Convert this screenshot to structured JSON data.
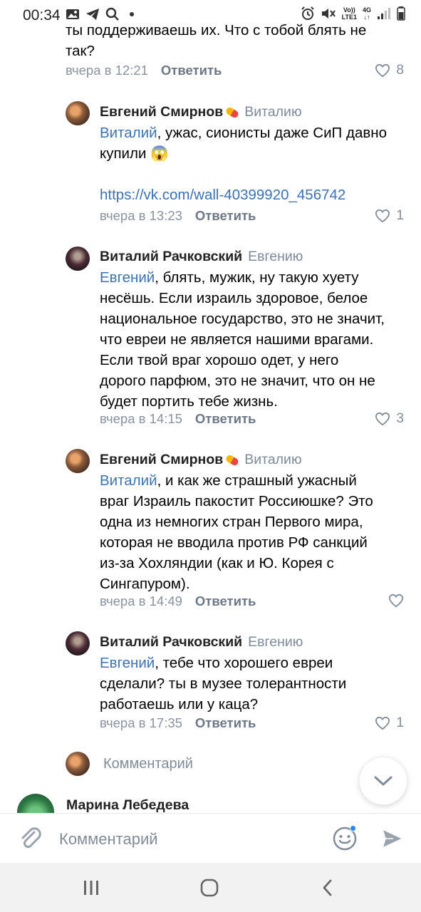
{
  "status": {
    "time": "00:34",
    "net_top": "Vo))",
    "net_bottom": "LTE1",
    "net_4g": "4G"
  },
  "top_partial": {
    "line1": "ты поддерживаешь их.  Что с тобой блять не",
    "line2": "так?",
    "time": "вчера в 12:21",
    "reply_label": "Ответить",
    "likes": "8"
  },
  "comments": [
    {
      "author": "Евгений Смирнов",
      "reply_to": "Виталию",
      "mention": "Виталий",
      "text_lines": [
        ", ужас, сионисты даже СиП давно",
        "купили 😱"
      ],
      "link": "https://vk.com/wall-40399920_456742",
      "time": "вчера в 13:23",
      "reply_label": "Ответить",
      "likes": "1"
    },
    {
      "author": "Виталий Рачковский",
      "reply_to": "Евгению",
      "mention": "Евгений",
      "text_lines": [
        ", блять, мужик, ну такую хуету",
        "несёшь. Если израиль здоровое, белое",
        "национальное государство, это не значит,",
        "что евреи не является нашими врагами.",
        "Если твой враг хорошо одет, у него",
        "дорого парфюм, это не значит, что он не",
        "будет портить тебе жизнь."
      ],
      "time": "вчера в 14:15",
      "reply_label": "Ответить",
      "likes": "3"
    },
    {
      "author": "Евгений Смирнов",
      "reply_to": "Виталию",
      "mention": "Виталий",
      "text_lines": [
        ", и как же страшный ужасный",
        "враг Израиль пакостит Россиюшке? Это",
        "одна из немногих стран Первого мира,",
        "которая не вводила против РФ санкций",
        "из-за Хохляндии (как и Ю. Корея с",
        "Сингапуром)."
      ],
      "time": "вчера в 14:49",
      "reply_label": "Ответить",
      "likes": ""
    },
    {
      "author": "Виталий Рачковский",
      "reply_to": "Евгению",
      "mention": "Евгений",
      "text_lines": [
        ", тебе что хорошего евреи",
        "сделали? ты в музее толерантности",
        "работаешь или у каца?"
      ],
      "time": "вчера в 17:35",
      "reply_label": "Ответить",
      "likes": "1"
    }
  ],
  "reply_box": {
    "placeholder": "Комментарий"
  },
  "next_comment": {
    "author": "Марина Лебедева"
  },
  "input_bar": {
    "placeholder": "Комментарий"
  },
  "colors": {
    "link": "#3d72b0",
    "meta": "#8a939f",
    "accent": "#2787f5"
  }
}
